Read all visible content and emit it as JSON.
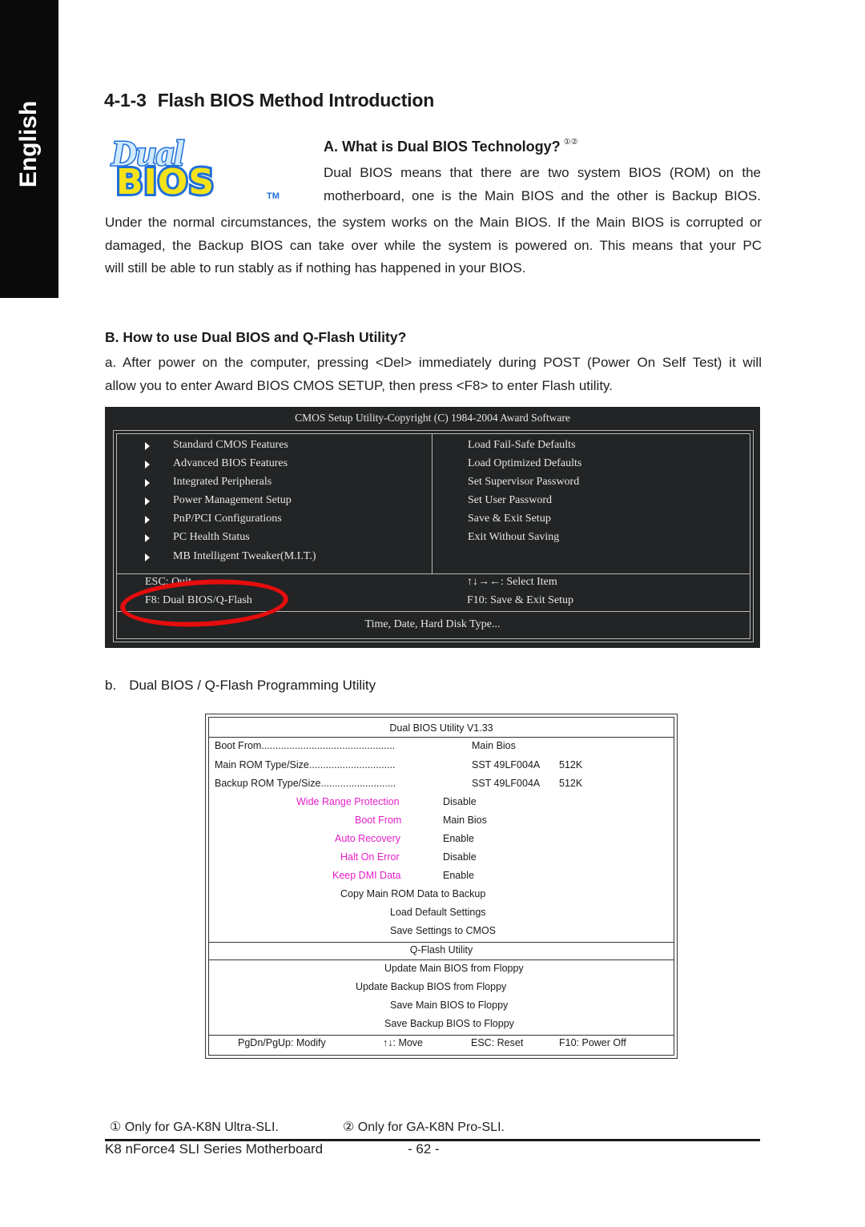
{
  "side_tab": {
    "label": "English"
  },
  "section": {
    "number": "4-1-3",
    "title": "Flash BIOS Method Introduction"
  },
  "logo": {
    "word1": "Dual",
    "word2": "BIOS",
    "tm": "TM",
    "colors": {
      "blue": "#1f6fd8",
      "yellow": "#f5e21a",
      "light": "#cfe9ff"
    }
  },
  "part_a": {
    "heading": "A.   What is Dual BIOS Technology?",
    "superscript": "①②",
    "intro_lines": [
      "Dual BIOS means that there are two system BIOS (ROM) on the",
      "motherboard, one is the Main BIOS and the other is Backup BIOS."
    ],
    "body_lines": [
      "Under the normal circumstances, the system works on the Main BIOS. If the Main BIOS is corrupted or",
      "damaged, the Backup BIOS can take over while the system is powered on. This means that your PC",
      "will still be able to run stably as if nothing has happened in your BIOS."
    ]
  },
  "part_b": {
    "heading": "B.   How to use Dual BIOS and Q-Flash Utility?",
    "body_lines": [
      "a. After power on the computer, pressing <Del> immediately during POST (Power On Self Test) it will",
      "allow you to enter Award BIOS CMOS SETUP, then press <F8> to enter Flash utility."
    ]
  },
  "cmos": {
    "title": "CMOS Setup Utility-Copyright (C) 1984-2004 Award Software",
    "left_items": [
      "Standard CMOS Features",
      "Advanced BIOS Features",
      "Integrated Peripherals",
      "Power Management Setup",
      "PnP/PCI Configurations",
      "PC Health Status",
      "MB Intelligent Tweaker(M.I.T.)"
    ],
    "right_items": [
      "Load Fail-Safe Defaults",
      "Load Optimized Defaults",
      "Set Supervisor Password",
      "Set User Password",
      "Save & Exit Setup",
      "Exit Without Saving"
    ],
    "keys_left": [
      "ESC: Quit",
      "F8: Dual BIOS/Q-Flash"
    ],
    "keys_right": [
      "↑↓→←: Select Item",
      "F10: Save & Exit Setup"
    ],
    "help": "Time, Date, Hard Disk Type...",
    "highlight_color": "#e50d0d"
  },
  "sub_b": {
    "label": "b.",
    "text": "Dual BIOS / Q-Flash Programming Utility"
  },
  "dual_bios_utility": {
    "title": "Dual BIOS Utility V1.33",
    "info_rows": [
      {
        "label": "Boot From................................................",
        "value": "Main Bios",
        "size": ""
      },
      {
        "label": "Main ROM Type/Size...............................",
        "value": "SST 49LF004A",
        "size": "512K"
      },
      {
        "label": "Backup ROM Type/Size...........................",
        "value": "SST 49LF004A",
        "size": "512K"
      }
    ],
    "settings": [
      {
        "label": "Wide Range Protection",
        "value": "Disable"
      },
      {
        "label": "Boot From",
        "value": "Main Bios"
      },
      {
        "label": "Auto Recovery",
        "value": "Enable"
      },
      {
        "label": "Halt On Error",
        "value": "Disable"
      },
      {
        "label": "Keep DMI Data",
        "value": "Enable"
      }
    ],
    "actions": [
      "Copy Main ROM Data to Backup",
      "Load Default Settings",
      "Save Settings to CMOS"
    ],
    "qflash_title": "Q-Flash Utility",
    "qflash_actions": [
      "Update Main BIOS from Floppy",
      "Update Backup BIOS from Floppy",
      "Save Main BIOS to Floppy",
      "Save Backup BIOS to Floppy"
    ],
    "keys": [
      "PgDn/PgUp: Modify",
      "↑↓: Move",
      "ESC: Reset",
      "F10: Power Off"
    ],
    "setting_label_color": "#e61ec8"
  },
  "footnotes": {
    "note1": "① Only for GA-K8N Ultra-SLI.",
    "note2": "② Only for GA-K8N Pro-SLI."
  },
  "footer": {
    "title": "K8 nForce4 SLI Series Motherboard",
    "page": "- 62 -"
  }
}
